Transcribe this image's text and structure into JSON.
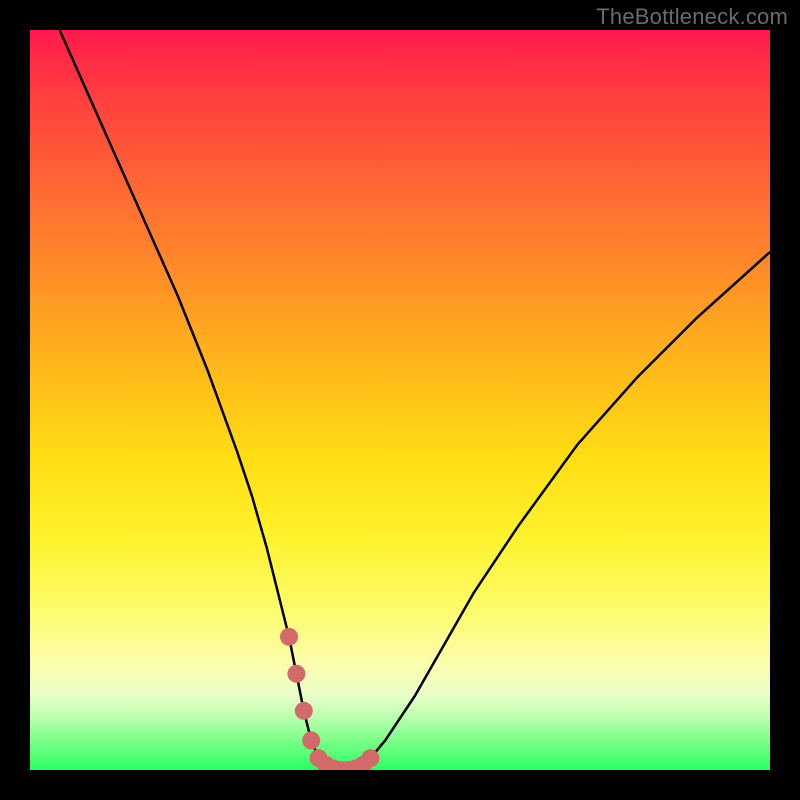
{
  "watermark": {
    "text": "TheBottleneck.com"
  },
  "chart_data": {
    "type": "line",
    "title": "",
    "xlabel": "",
    "ylabel": "",
    "xlim": [
      0,
      100
    ],
    "ylim": [
      0,
      100
    ],
    "grid": false,
    "legend": false,
    "series": [
      {
        "name": "bottleneck-curve",
        "color": "#000000",
        "x": [
          4,
          8,
          12,
          16,
          20,
          24,
          28,
          30,
          32,
          34,
          35,
          36,
          37,
          38,
          39,
          40,
          41,
          42,
          43,
          44,
          45,
          46,
          48,
          52,
          56,
          60,
          66,
          74,
          82,
          90,
          100
        ],
        "y": [
          100,
          91,
          82,
          73,
          64,
          54,
          43,
          37,
          30,
          22,
          18,
          13,
          8,
          4,
          1.6,
          0.7,
          0.2,
          0,
          0,
          0.2,
          0.7,
          1.6,
          4,
          10,
          17,
          24,
          33,
          44,
          53,
          61,
          70
        ]
      },
      {
        "name": "marker-dots",
        "color": "#d36a6a",
        "type": "scatter",
        "x": [
          35,
          36,
          37,
          38,
          39,
          40,
          41,
          42,
          43,
          44,
          45,
          46
        ],
        "y": [
          18,
          13,
          8,
          4,
          1.6,
          0.7,
          0.2,
          0,
          0,
          0.2,
          0.7,
          1.6
        ]
      }
    ],
    "background_gradient": {
      "orientation": "vertical",
      "stops": [
        {
          "pos": 0.0,
          "color": "#ff1a4d"
        },
        {
          "pos": 0.35,
          "color": "#ff9126"
        },
        {
          "pos": 0.65,
          "color": "#fff12a"
        },
        {
          "pos": 0.9,
          "color": "#e8ffc9"
        },
        {
          "pos": 1.0,
          "color": "#2bff63"
        }
      ]
    }
  }
}
